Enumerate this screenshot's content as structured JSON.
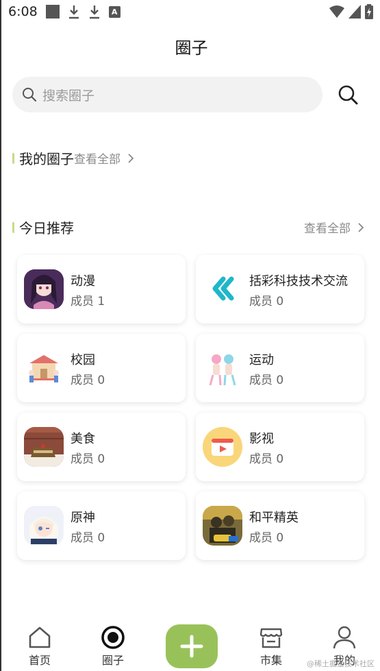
{
  "status_bar": {
    "time": "6:08",
    "indicator": "A"
  },
  "header": {
    "title": "圈子"
  },
  "search": {
    "placeholder": "搜索圈子"
  },
  "my_circles": {
    "title": "我的圈子",
    "view_all": "查看全部"
  },
  "recommend": {
    "title": "今日推荐",
    "view_all": "查看全部",
    "cards": [
      {
        "name": "动漫",
        "members": "成员 1",
        "icon": "anime-girl-avatar"
      },
      {
        "name": "括彩科技技术交流",
        "members": "成员 0",
        "icon": "double-chevron-logo"
      },
      {
        "name": "校园",
        "members": "成员 0",
        "icon": "campus-gate-avatar"
      },
      {
        "name": "运动",
        "members": "成员 0",
        "icon": "sport-girls-avatar"
      },
      {
        "name": "美食",
        "members": "成员 0",
        "icon": "cake-avatar"
      },
      {
        "name": "影视",
        "members": "成员 0",
        "icon": "video-play-avatar"
      },
      {
        "name": "原神",
        "members": "成员 0",
        "icon": "genshin-character-avatar"
      },
      {
        "name": "和平精英",
        "members": "成员 0",
        "icon": "game-soldier-avatar"
      }
    ]
  },
  "tabs": [
    {
      "label": "首页",
      "icon": "home-icon"
    },
    {
      "label": "圈子",
      "icon": "circle-target-icon",
      "active": true
    },
    {
      "label": "",
      "icon": "plus-icon"
    },
    {
      "label": "市集",
      "icon": "store-icon"
    },
    {
      "label": "我的",
      "icon": "user-icon"
    }
  ],
  "watermark": "@稀土掘金技术社区",
  "colors": {
    "accent": "#98c259",
    "section_bar": "#c6dc88",
    "search_bg": "#f2f2f2"
  }
}
